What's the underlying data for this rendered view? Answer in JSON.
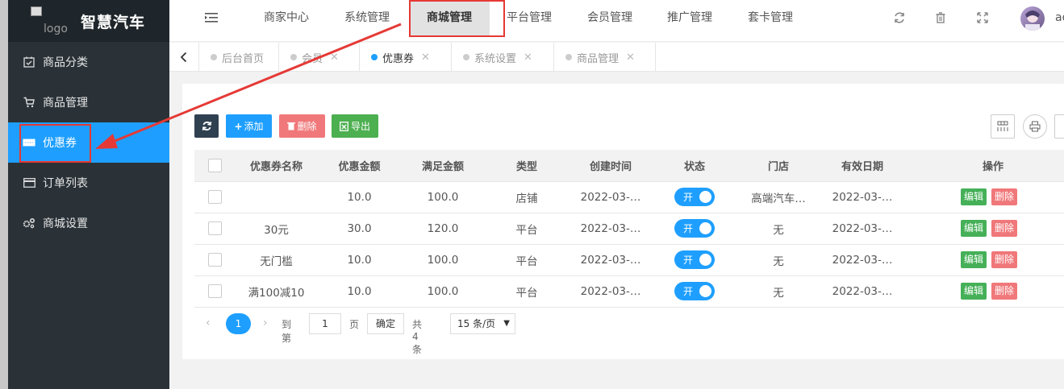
{
  "app": {
    "title": "智慧汽车",
    "logo_alt": "logo"
  },
  "sidebar": {
    "items": [
      {
        "label": "商品分类",
        "icon": "calendar-check-icon"
      },
      {
        "label": "商品管理",
        "icon": "cart-icon"
      },
      {
        "label": "优惠券",
        "icon": "coupon-icon",
        "active": true
      },
      {
        "label": "订单列表",
        "icon": "credit-card-icon"
      },
      {
        "label": "商城设置",
        "icon": "gears-icon"
      }
    ]
  },
  "topnav": {
    "items": [
      "商家中心",
      "系统管理",
      "商城管理",
      "平台管理",
      "会员管理",
      "推广管理",
      "套卡管理"
    ],
    "active": "商城管理",
    "user": "ad"
  },
  "tabs": {
    "items": [
      "后台首页",
      "会员",
      "优惠券",
      "系统设置",
      "商品管理"
    ],
    "active": "优惠券"
  },
  "toolbar": {
    "refresh_icon": "refresh-icon",
    "add_label": "添加",
    "delete_label": "删除",
    "export_label": "导出"
  },
  "table": {
    "columns": [
      "优惠券名称",
      "优惠金额",
      "满足金额",
      "类型",
      "创建时间",
      "状态",
      "门店",
      "有效日期",
      "操作"
    ],
    "rows": [
      {
        "name": "",
        "amount": "10.0",
        "threshold": "100.0",
        "type": "店铺",
        "created": "2022-03-…",
        "status": "开",
        "store": "高端汽车…",
        "valid": "2022-03-…"
      },
      {
        "name": "30元",
        "amount": "30.0",
        "threshold": "120.0",
        "type": "平台",
        "created": "2022-03-…",
        "status": "开",
        "store": "无",
        "valid": "2022-03-…"
      },
      {
        "name": "无门槛",
        "amount": "10.0",
        "threshold": "100.0",
        "type": "平台",
        "created": "2022-03-…",
        "status": "开",
        "store": "无",
        "valid": "2022-03-…"
      },
      {
        "name": "满100减10",
        "amount": "10.0",
        "threshold": "100.0",
        "type": "平台",
        "created": "2022-03-…",
        "status": "开",
        "store": "无",
        "valid": "2022-03-…"
      }
    ],
    "edit_label": "编辑",
    "delete_label": "删除"
  },
  "pager": {
    "current": "1",
    "goto_prefix": "到第",
    "goto_value": "1",
    "goto_suffix": "页",
    "confirm": "确定",
    "total": "共 4 条",
    "page_size": "15 条/页"
  },
  "colors": {
    "accent": "#1e9fff",
    "sidebar": "#2a3238",
    "highlight": "#e53935"
  }
}
